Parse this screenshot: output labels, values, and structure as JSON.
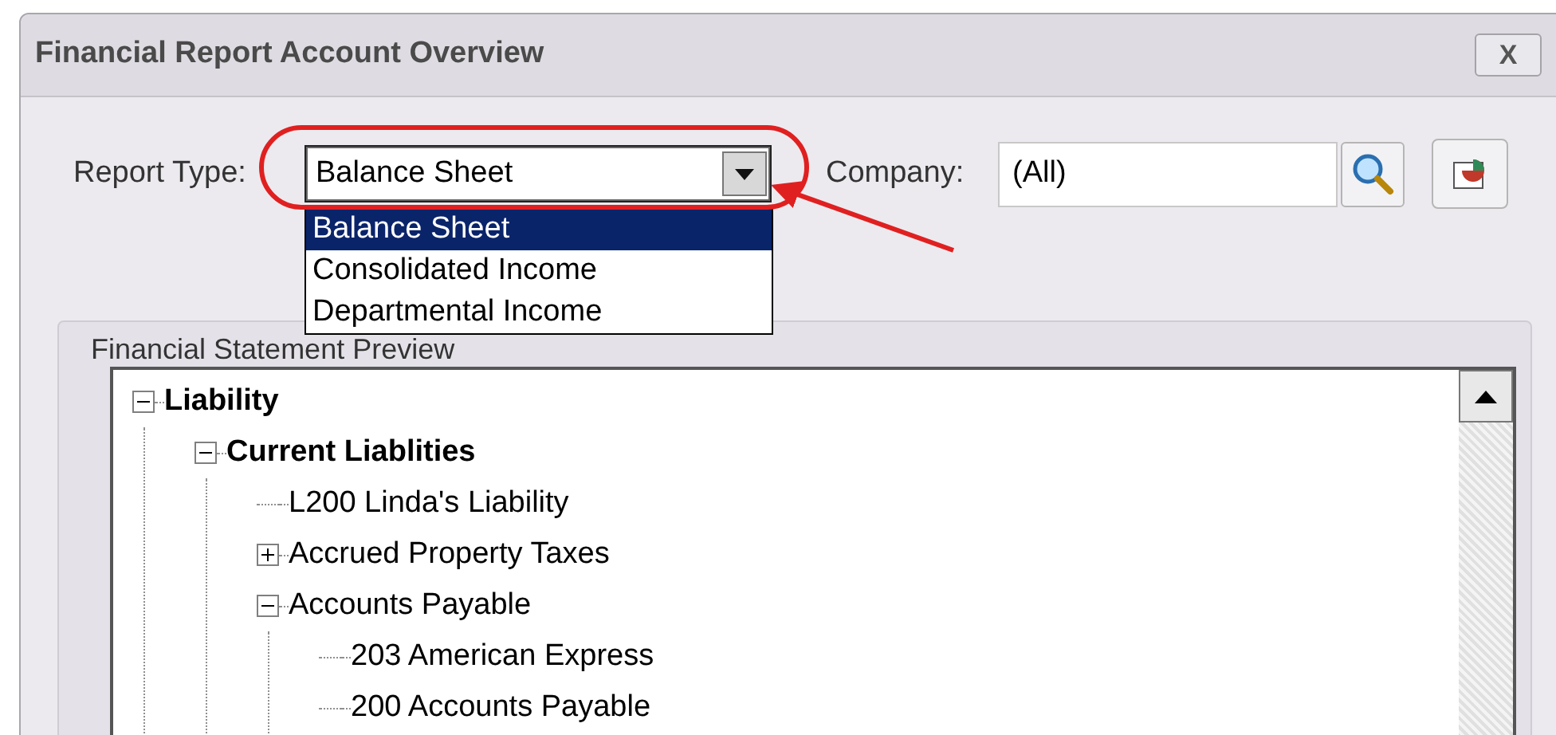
{
  "window": {
    "title": "Financial Report Account Overview",
    "close_button": "X"
  },
  "report_type": {
    "label": "Report Type:",
    "value": "Balance Sheet",
    "expanded": true,
    "options": [
      {
        "label": "Balance Sheet",
        "selected": true
      },
      {
        "label": "Consolidated Income",
        "selected": false
      },
      {
        "label": "Departmental Income",
        "selected": false
      }
    ]
  },
  "company": {
    "label": "Company:",
    "value": "(All)"
  },
  "preview": {
    "title": "Financial Statement Preview",
    "tree": [
      {
        "label": "Liability",
        "bold": true,
        "expanded": true,
        "children": [
          {
            "label": "Current Liablities",
            "bold": true,
            "expanded": true,
            "children": [
              {
                "label": "L200 Linda's Liability",
                "bold": false
              },
              {
                "label": "Accrued Property Taxes",
                "bold": false,
                "expanded": false
              },
              {
                "label": "Accounts Payable",
                "bold": false,
                "expanded": true,
                "children": [
                  {
                    "label": "203 American Express",
                    "bold": false
                  },
                  {
                    "label": "200 Accounts Payable",
                    "bold": false
                  }
                ]
              }
            ]
          }
        ]
      }
    ]
  }
}
